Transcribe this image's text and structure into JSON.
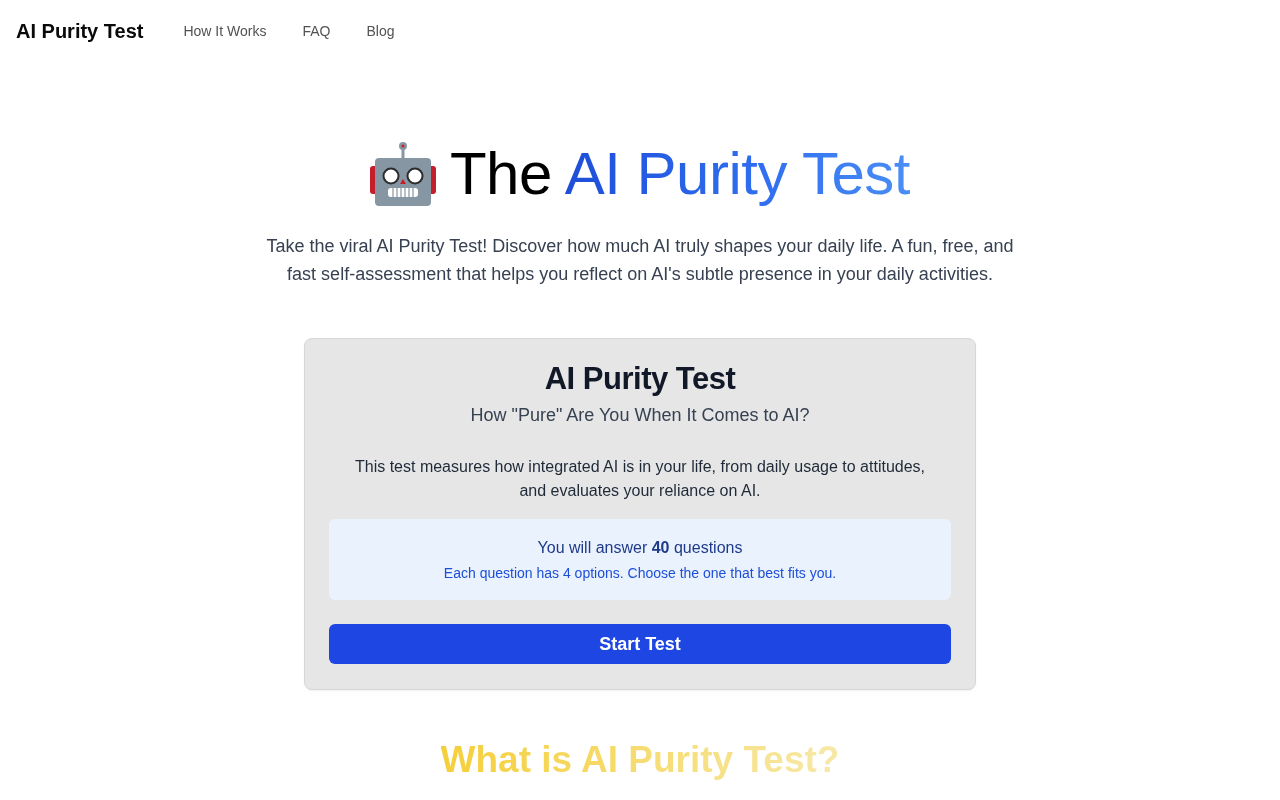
{
  "nav": {
    "logo": "AI Purity Test",
    "links": [
      "How It Works",
      "FAQ",
      "Blog"
    ]
  },
  "hero": {
    "title_lead": "The",
    "title_highlight": "AI Purity Test",
    "subtitle": "Take the viral AI Purity Test! Discover how much AI truly shapes your daily life. A fun, free, and fast self-assessment that helps you reflect on AI's subtle presence in your daily activities."
  },
  "card": {
    "title": "AI Purity Test",
    "subtitle": "How \"Pure\" Are You When It Comes to AI?",
    "description": "This test measures how integrated AI is in your life, from daily usage to attitudes, and evaluates your reliance on AI.",
    "info": {
      "headline": "You will answer **40** questions",
      "note": "Each question has 4 options. Choose the one that best fits you."
    },
    "button": "Start Test"
  },
  "section_title": "What is AI Purity Test?"
}
